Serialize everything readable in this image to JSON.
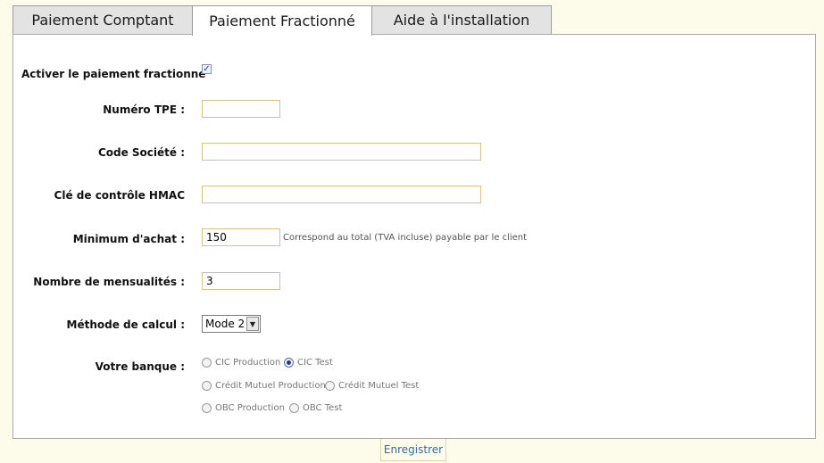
{
  "tabs": [
    {
      "label": "Paiement Comptant"
    },
    {
      "label": "Paiement Fractionné"
    },
    {
      "label": "Aide à l'installation"
    }
  ],
  "active_tab": "Paiement Fractionné",
  "form": {
    "enable_label": "Activer le paiement fractionné",
    "enable_checked": true,
    "tpe_label": "Numéro TPE :",
    "tpe_value": "",
    "company_label": "Code Société :",
    "company_value": "",
    "hmac_label": "Clé de contrôle HMAC",
    "hmac_value": "",
    "min_label": "Minimum d'achat :",
    "min_value": "150",
    "min_help": "Correspond au total (TVA incluse) payable par le client",
    "installments_label": "Nombre de mensualités :",
    "installments_value": "3",
    "method_label": "Méthode de calcul :",
    "method_value": "Mode 2",
    "bank_label": "Votre banque :",
    "banks": [
      {
        "label": "CIC Production",
        "selected": false
      },
      {
        "label": "CIC Test",
        "selected": true
      },
      {
        "label": "Crédit Mutuel Production",
        "selected": false
      },
      {
        "label": "Crédit Mutuel Test",
        "selected": false
      },
      {
        "label": "OBC Production",
        "selected": false
      },
      {
        "label": "OBC Test",
        "selected": false
      }
    ]
  },
  "save_label": "Enregistrer",
  "colors": {
    "page_background": "#fdfcea",
    "tab_inactive": "#e3e3e3",
    "input_border": "#d4c489",
    "link_blue": "#2d6db7"
  }
}
